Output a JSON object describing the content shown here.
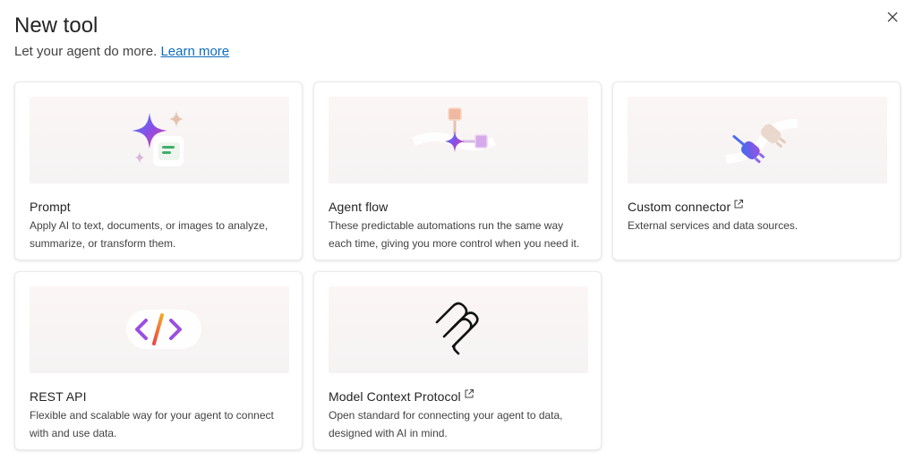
{
  "header": {
    "title": "New tool",
    "subtitle": "Let your agent do more.",
    "learn_more": "Learn more"
  },
  "close_icon": "close-icon",
  "cards": {
    "prompt": {
      "name": "Prompt",
      "description": "Apply AI to text, documents, or images to analyze, summarize, or transform them.",
      "icon": "sparkle-icon"
    },
    "agent_flow": {
      "name": "Agent flow",
      "description": "These predictable automations run the same way each time, giving you more control when you need it.",
      "icon": "flow-icon"
    },
    "custom_connector": {
      "name": "Custom connector",
      "description": "External services and data sources.",
      "icon": "plug-icon",
      "external": true
    },
    "rest_api": {
      "name": "REST API",
      "description": "Flexible and scalable way for your agent to connect with and use data.",
      "icon": "code-icon"
    },
    "mcp": {
      "name": "Model Context Protocol",
      "description": "Open standard for connecting your agent to data, designed with AI in mind.",
      "icon": "mcp-icon",
      "external": true
    }
  },
  "colors": {
    "link": "#0f6cbd",
    "text": "#242424",
    "secondary_text": "#424242"
  }
}
